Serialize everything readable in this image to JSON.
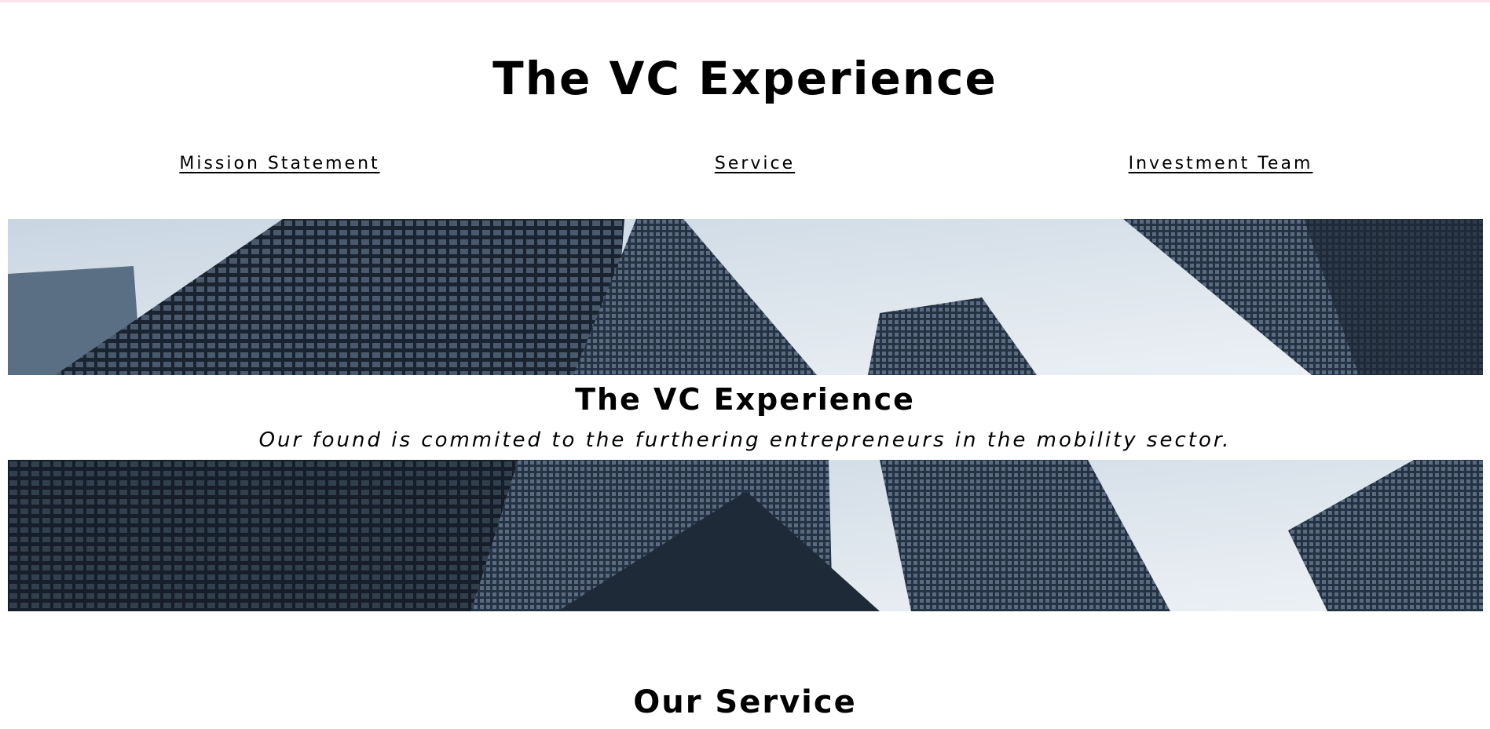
{
  "header": {
    "title": "The VC Experience"
  },
  "nav": {
    "items": [
      {
        "label": "Mission Statement"
      },
      {
        "label": "Service"
      },
      {
        "label": "Investment Team"
      }
    ]
  },
  "hero": {
    "title": "The VC Experience",
    "tagline": "Our found is commited to the furthering entrepreneurs in the mobility sector."
  },
  "services": {
    "title": "Our Service"
  },
  "colors": {
    "accent_bar": "#fde4ea",
    "sky": "#dfe8f0",
    "building": "#1c2633"
  }
}
